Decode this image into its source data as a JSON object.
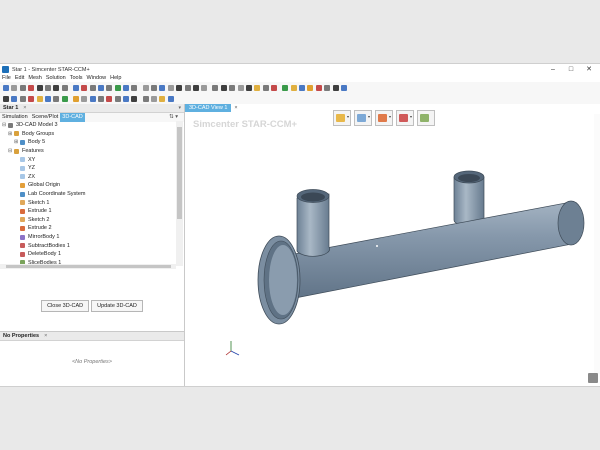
{
  "window": {
    "title": "Star 1 - Simcenter STAR-CCM+",
    "controls": [
      "–",
      "□",
      "✕"
    ]
  },
  "menu": [
    "File",
    "Edit",
    "Mesh",
    "Solution",
    "Tools",
    "Window",
    "Help"
  ],
  "left_panel": {
    "header": "Star 1",
    "close": "×",
    "tabs": [
      {
        "label": "Simulation",
        "active": false
      },
      {
        "label": "Scene/Plot",
        "active": false
      },
      {
        "label": "3D-CAD",
        "active": true
      }
    ],
    "tree": [
      {
        "label": "3D-CAD Model 3",
        "icon": "model-icon",
        "color": "#7a7a7a",
        "depth": 0,
        "exp": "⊟"
      },
      {
        "label": "Body Groups",
        "icon": "folder-icon",
        "color": "#d9a13c",
        "depth": 1,
        "exp": "⊞"
      },
      {
        "label": "Body 5",
        "icon": "body-icon",
        "color": "#4e8fc7",
        "depth": 2,
        "exp": "⊞"
      },
      {
        "label": "Features",
        "icon": "folder-icon",
        "color": "#d9a13c",
        "depth": 1,
        "exp": "⊟"
      },
      {
        "label": "XY",
        "icon": "plane-icon",
        "color": "#a7c7e7",
        "depth": 2,
        "exp": ""
      },
      {
        "label": "YZ",
        "icon": "plane-icon",
        "color": "#a7c7e7",
        "depth": 2,
        "exp": ""
      },
      {
        "label": "ZX",
        "icon": "plane-icon",
        "color": "#a7c7e7",
        "depth": 2,
        "exp": ""
      },
      {
        "label": "Global Origin",
        "icon": "origin-icon",
        "color": "#e39f3a",
        "depth": 2,
        "exp": ""
      },
      {
        "label": "Lab Coordinate System",
        "icon": "coordinate-system-icon",
        "color": "#4e8fc7",
        "depth": 2,
        "exp": ""
      },
      {
        "label": "Sketch 1",
        "icon": "sketch-icon",
        "color": "#e0a85a",
        "depth": 2,
        "exp": ""
      },
      {
        "label": "Extrude 1",
        "icon": "extrude-icon",
        "color": "#d96b3c",
        "depth": 2,
        "exp": ""
      },
      {
        "label": "Sketch 2",
        "icon": "sketch-icon",
        "color": "#e0a85a",
        "depth": 2,
        "exp": ""
      },
      {
        "label": "Extrude 2",
        "icon": "extrude-icon",
        "color": "#d96b3c",
        "depth": 2,
        "exp": ""
      },
      {
        "label": "MirrorBody 1",
        "icon": "mirror-icon",
        "color": "#8c73c7",
        "depth": 2,
        "exp": ""
      },
      {
        "label": "SubtractBodies 1",
        "icon": "subtract-icon",
        "color": "#c75b5b",
        "depth": 2,
        "exp": ""
      },
      {
        "label": "DeleteBody 1",
        "icon": "delete-icon",
        "color": "#c75b5b",
        "depth": 2,
        "exp": ""
      },
      {
        "label": "SliceBodies 1",
        "icon": "slice-icon",
        "color": "#7aa35b",
        "depth": 2,
        "exp": ""
      }
    ],
    "buttons": {
      "close": "Close 3D-CAD",
      "update": "Update 3D-CAD"
    }
  },
  "properties_panel": {
    "header": "No Properties",
    "close": "×",
    "placeholder": "<No Properties>"
  },
  "viewport": {
    "tab": "3D-CAD View 1",
    "close": "×",
    "brand": "Simcenter STAR-CCM+",
    "model_color": "#7d90a5",
    "toolbar": [
      "view-orientation-icon",
      "display-style-icon",
      "section-icon",
      "visibility-icon",
      "scene-icon"
    ]
  }
}
